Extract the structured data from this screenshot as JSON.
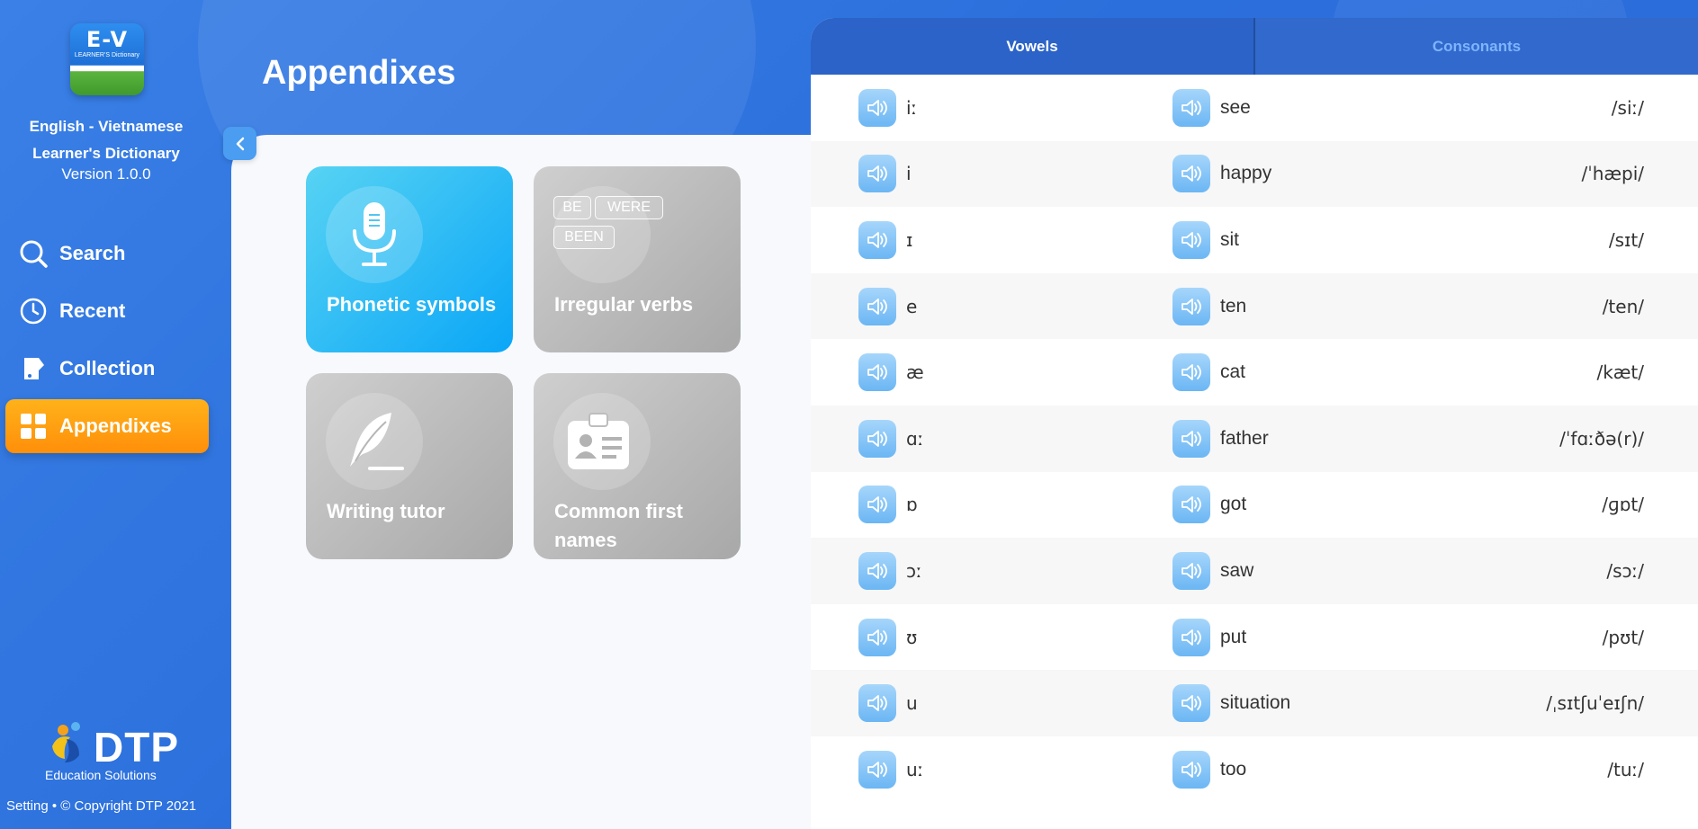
{
  "app": {
    "logo_text": "E-V",
    "logo_subtext": "LEARNER'S Dictionary",
    "name_line1": "English - Vietnamese",
    "name_line2": "Learner's Dictionary",
    "version": "Version 1.0.0"
  },
  "nav": {
    "items": [
      {
        "label": "Search",
        "icon": "search-icon"
      },
      {
        "label": "Recent",
        "icon": "clock-icon"
      },
      {
        "label": "Collection",
        "icon": "bookmark-icon"
      },
      {
        "label": "Appendixes",
        "icon": "grid-icon",
        "active": true
      }
    ]
  },
  "brand": {
    "name": "DTP",
    "tagline": "Education Solutions"
  },
  "footer": {
    "text": "Setting • © Copyright DTP 2021"
  },
  "page": {
    "title": "Appendixes"
  },
  "cards": [
    {
      "label": "Phonetic symbols",
      "icon": "microphone-icon",
      "active": true
    },
    {
      "label": "Irregular verbs",
      "icon": "verb-tags-icon",
      "tags": [
        "BE",
        "WERE",
        "BEEN"
      ]
    },
    {
      "label": "Writing tutor",
      "icon": "quill-icon"
    },
    {
      "label": "Common first names",
      "icon": "id-card-icon"
    }
  ],
  "tabs": {
    "vowels": "Vowels",
    "consonants": "Consonants",
    "active": "vowels"
  },
  "vowels": [
    {
      "symbol": "iː",
      "word": "see",
      "ipa": "/siː/"
    },
    {
      "symbol": "i",
      "word": "happy",
      "ipa": "/ˈhæpi/"
    },
    {
      "symbol": "ɪ",
      "word": "sit",
      "ipa": "/sɪt/"
    },
    {
      "symbol": "e",
      "word": "ten",
      "ipa": "/ten/"
    },
    {
      "symbol": "æ",
      "word": "cat",
      "ipa": "/kæt/"
    },
    {
      "symbol": "ɑː",
      "word": "father",
      "ipa": "/ˈfɑːðə(r)/"
    },
    {
      "symbol": "ɒ",
      "word": "got",
      "ipa": "/ɡɒt/"
    },
    {
      "symbol": "ɔː",
      "word": "saw",
      "ipa": "/sɔː/"
    },
    {
      "symbol": "ʊ",
      "word": "put",
      "ipa": "/pʊt/"
    },
    {
      "symbol": "u",
      "word": "situation",
      "ipa": "/ˌsɪtʃuˈeɪʃn/"
    },
    {
      "symbol": "uː",
      "word": "too",
      "ipa": "/tuː/"
    }
  ],
  "colors": {
    "accent": "#ff9a12",
    "primary": "#2f74e0",
    "card_active": "#1ab2f5"
  }
}
